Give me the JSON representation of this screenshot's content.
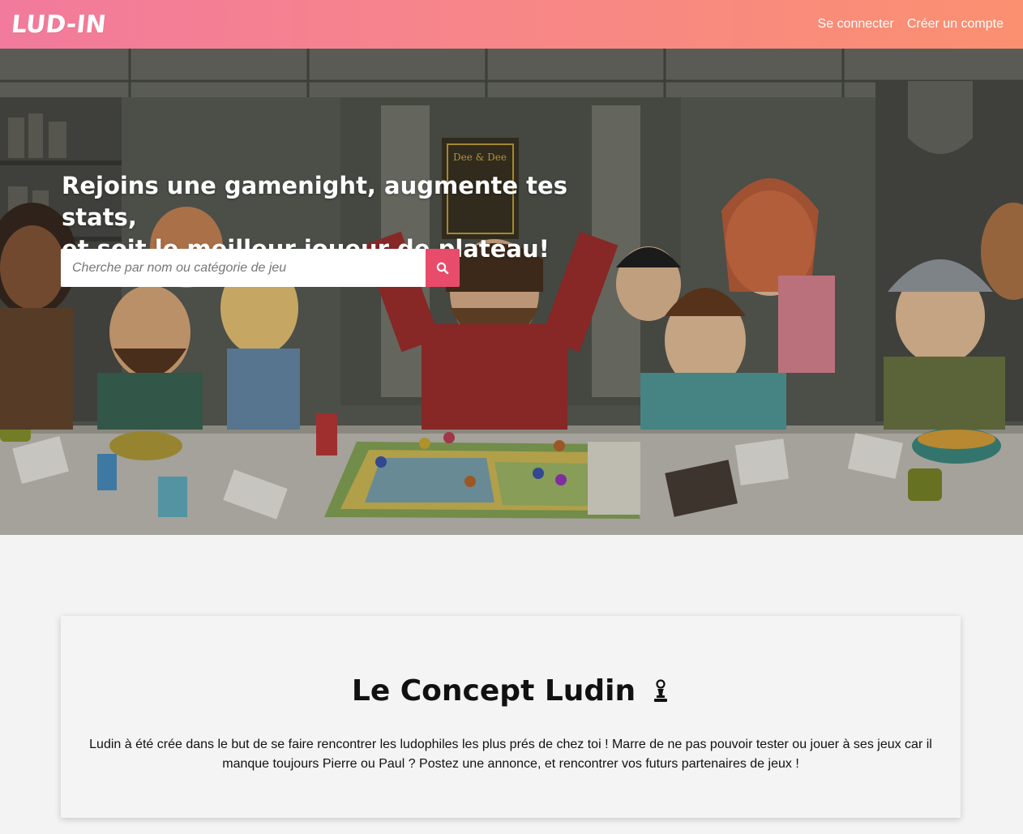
{
  "navbar": {
    "logo": "LUD-IN",
    "links": {
      "login": "Se connecter",
      "signup": "Créer un compte"
    }
  },
  "hero": {
    "title_line1": "Rejoins une gamenight, augmente tes stats,",
    "title_line2": "et soit le meilleur joueur de plateau!",
    "search": {
      "placeholder": "Cherche par nom ou catégorie de jeu",
      "value": ""
    },
    "book_title": "Dee & Dee",
    "colors": {
      "accent": "#e94b6a",
      "nav_start": "#f27a9c",
      "nav_end": "#fa9070"
    }
  },
  "concept": {
    "title": "Le Concept Ludin",
    "icon": "chess-pawn-icon",
    "text": "Ludin à été crée dans le but de se faire rencontrer les ludophiles les plus prés de chez toi ! Marre de ne pas pouvoir tester ou jouer à ses jeux car il manque toujours Pierre ou Paul ? Postez une annonce, et rencontrer vos futurs partenaires de jeux !"
  }
}
